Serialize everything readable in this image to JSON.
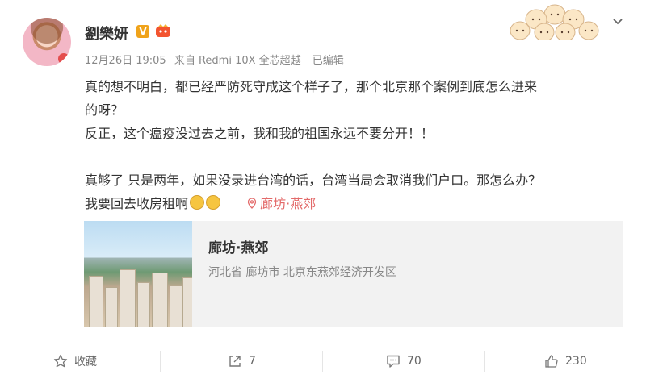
{
  "post": {
    "author": "劉樂妍",
    "time": "12月26日 19:05",
    "source": "来自 Redmi 10X 全芯超越",
    "edited": "已编辑",
    "lines": [
      "真的想不明白，都已经严防死守成这个样子了，那个北京那个案例到底怎么进来",
      "的呀？",
      "反正，这个瘟疫没过去之前，我和我的祖国永远不要分开！！",
      "",
      "真够了 只是两年，如果没录进台湾的话，台湾当局会取消我们户口。那怎么办？",
      "我要回去收房租啊"
    ],
    "location": "廊坊·燕郊"
  },
  "place_card": {
    "title": "廊坊·燕郊",
    "address": "河北省 廊坊市 北京东燕郊经济开发区"
  },
  "footer": {
    "favorite_label": "收藏",
    "repost_count": "7",
    "comment_count": "70",
    "like_count": "230"
  },
  "icons": [
    "vip-badge-icon",
    "chevron-down-icon",
    "location-pin-icon",
    "star-icon",
    "repost-icon",
    "comment-icon",
    "thumb-up-icon"
  ]
}
